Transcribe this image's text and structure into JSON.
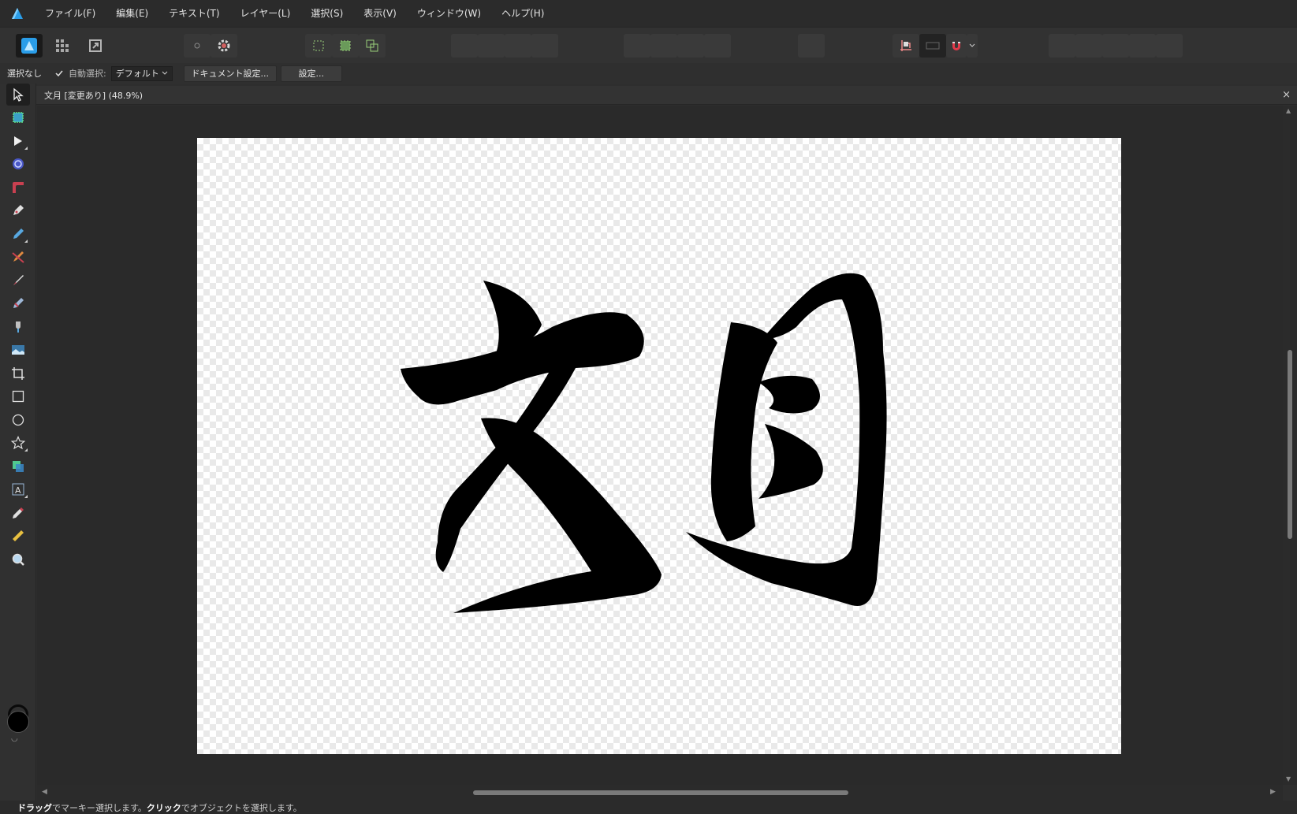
{
  "menu": {
    "items": [
      "ファイル(F)",
      "編集(E)",
      "テキスト(T)",
      "レイヤー(L)",
      "選択(S)",
      "表示(V)",
      "ウィンドウ(W)",
      "ヘルプ(H)"
    ]
  },
  "context": {
    "selection": "選択なし",
    "auto_select_label": "自動選択:",
    "auto_select_value": "デフォルト",
    "document_setup": "ドキュメント設定...",
    "settings": "設定..."
  },
  "document": {
    "tab_title": "文月 [変更あり] (48.9%)",
    "close": "×",
    "artwork_text": "文月"
  },
  "status": {
    "drag_bold": "ドラッグ",
    "drag_text": "でマーキー選択します。",
    "click_bold": "クリック",
    "click_text": "でオブジェクトを選択します。"
  },
  "colors": {
    "accent": "#2a9de8",
    "fill_color": "#000000",
    "snapping_magnet": "#e23a4a"
  },
  "tools": [
    "move-tool",
    "artboard-tool",
    "node-tool",
    "point-transform-tool",
    "corner-tool",
    "pen-tool",
    "pencil-tool",
    "vector-brush-tool",
    "fill-tool",
    "transparency-tool",
    "place-image-tool",
    "crop-tool",
    "rectangle-tool",
    "ellipse-tool",
    "star-tool",
    "shape-tool",
    "text-tool",
    "color-picker-tool",
    "measure-tool",
    "zoom-tool"
  ]
}
